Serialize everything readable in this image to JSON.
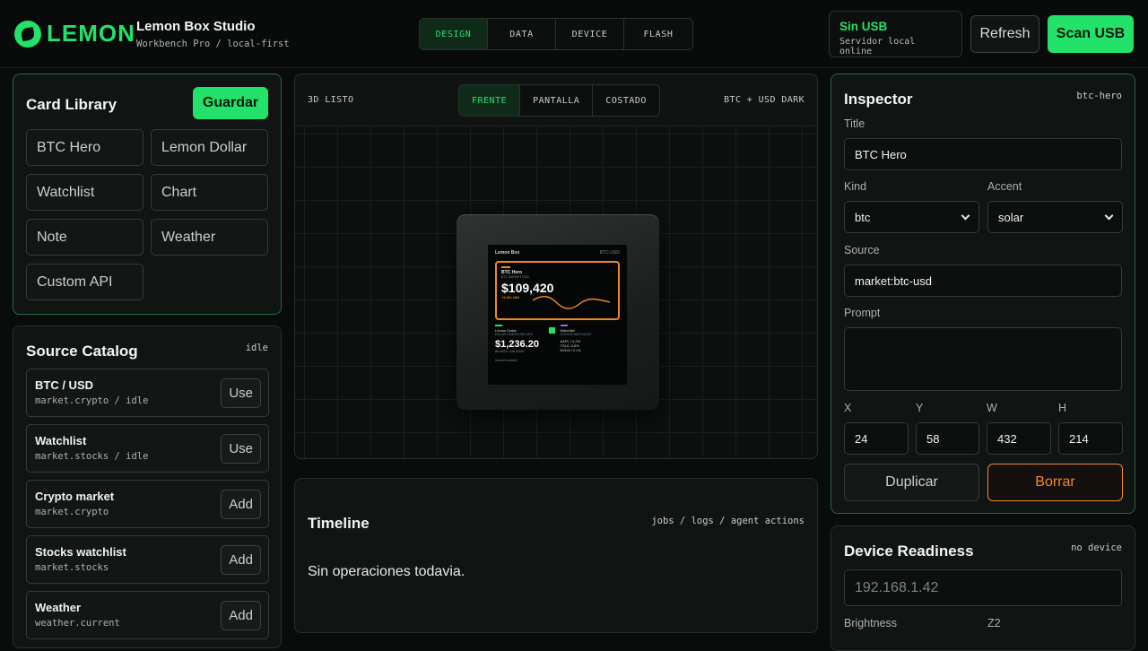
{
  "header": {
    "logo_text": "LEMON",
    "app_title": "Lemon Box Studio",
    "app_subtitle": "Workbench Pro / local-first",
    "mode_tabs": [
      "DESIGN",
      "DATA",
      "DEVICE",
      "FLASH"
    ],
    "active_mode": "DESIGN",
    "usb_title": "Sin USB",
    "usb_subtitle": "Servidor local online",
    "refresh_label": "Refresh",
    "scan_label": "Scan USB"
  },
  "library": {
    "title": "Card Library",
    "save_label": "Guardar",
    "items": [
      "BTC Hero",
      "Lemon Dollar",
      "Watchlist",
      "Chart",
      "Note",
      "Weather",
      "Custom API"
    ]
  },
  "sources": {
    "title": "Source Catalog",
    "status": "idle",
    "items": [
      {
        "name": "BTC / USD",
        "meta": "market.crypto / idle",
        "action": "Use"
      },
      {
        "name": "Watchlist",
        "meta": "market.stocks / idle",
        "action": "Use"
      },
      {
        "name": "Crypto market",
        "meta": "market.crypto",
        "action": "Add"
      },
      {
        "name": "Stocks watchlist",
        "meta": "market.stocks",
        "action": "Add"
      },
      {
        "name": "Weather",
        "meta": "weather.current",
        "action": "Add"
      }
    ]
  },
  "viewport": {
    "status": "3D LISTO",
    "tabs": [
      "FRENTE",
      "PANTALLA",
      "COSTADO"
    ],
    "active_tab": "FRENTE",
    "meta": "BTC + USD  DARK",
    "screen": {
      "brand": "Lemon Box",
      "time": "BTC-USD",
      "hero_name": "BTC Hero",
      "hero_sub": "BTC MARKET USD",
      "hero_price": "$109,420",
      "hero_change": "+2.4% 24H",
      "cell1_name": "Lemon Dollar",
      "cell1_sub": "DOLAR LEMON USD ARS",
      "cell1_value": "$1,236.20",
      "cell1_dim": "Bid $950 / Ask $1000",
      "cell2_name": "Watchlist",
      "cell2_sub": "STOCKS WATCHLIST",
      "cell2_rows": [
        "AAPL  +1.2%",
        "TSLA  -0.8%",
        "NVDA  +2.1%"
      ],
      "footer": "Sunset footnote"
    }
  },
  "timeline": {
    "title": "Timeline",
    "meta": "jobs / logs / agent actions",
    "empty": "Sin operaciones todavia."
  },
  "inspector": {
    "title": "Inspector",
    "id": "btc-hero",
    "title_label": "Title",
    "title_value": "BTC Hero",
    "kind_label": "Kind",
    "kind_value": "btc",
    "accent_label": "Accent",
    "accent_value": "solar",
    "source_label": "Source",
    "source_value": "market:btc-usd",
    "prompt_label": "Prompt",
    "x_label": "X",
    "y_label": "Y",
    "w_label": "W",
    "h_label": "H",
    "x_value": "24",
    "y_value": "58",
    "w_value": "432",
    "h_value": "214",
    "duplicate_label": "Duplicar",
    "delete_label": "Borrar"
  },
  "readiness": {
    "title": "Device Readiness",
    "status": "no device",
    "ip_placeholder": "192.168.1.42",
    "brightness_label": "Brightness",
    "tz_label": "Z2"
  },
  "colors": {
    "accent": "#22e26a",
    "warning": "#f08a24",
    "background": "#0a0c0b"
  }
}
